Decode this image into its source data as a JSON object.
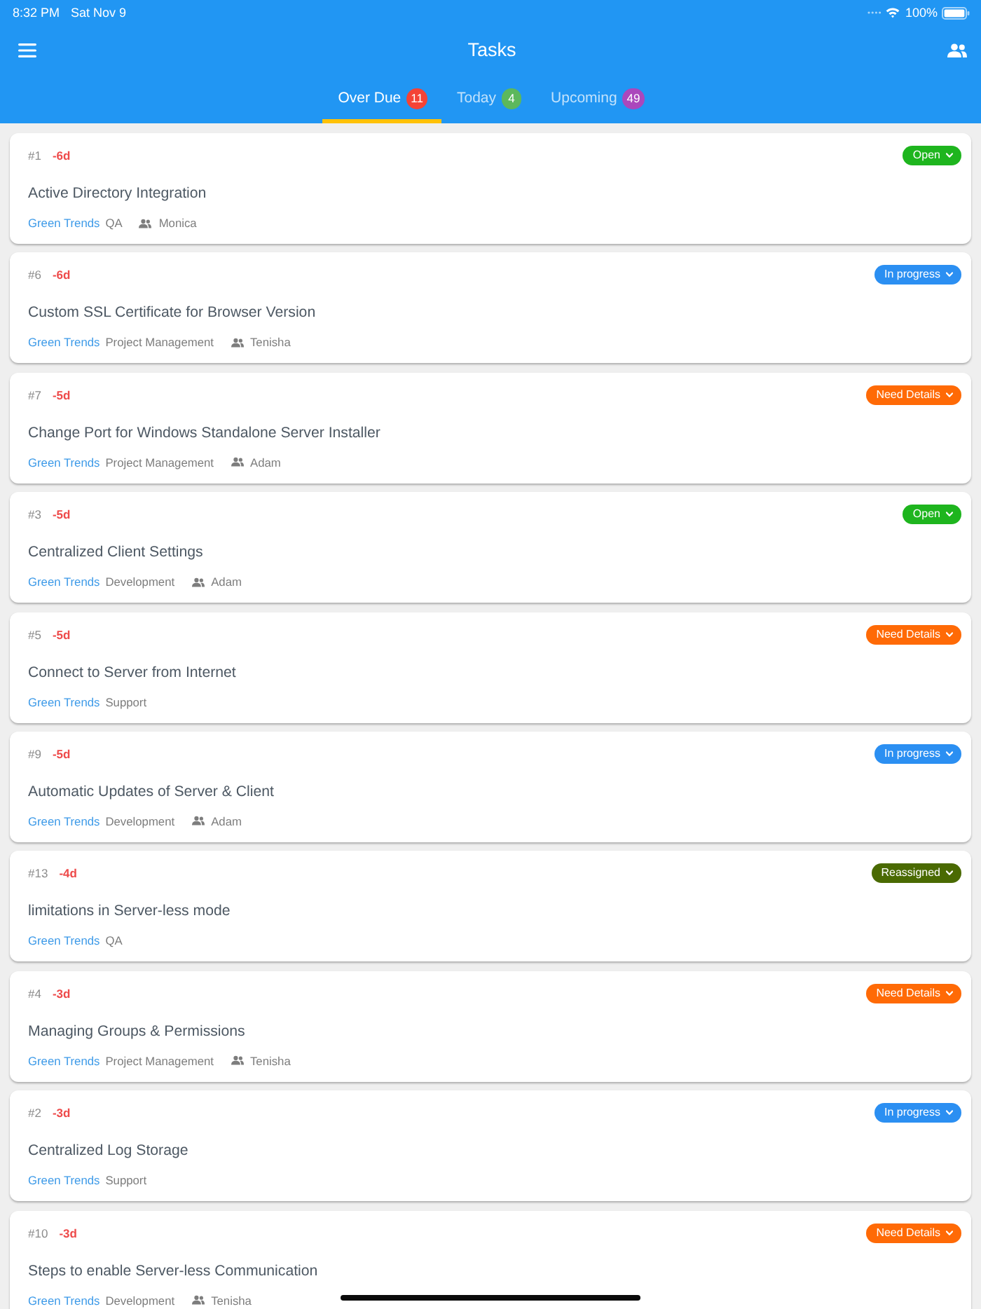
{
  "status_bar": {
    "time": "8:32 PM",
    "date": "Sat Nov 9",
    "battery": "100%"
  },
  "header": {
    "title": "Tasks"
  },
  "tabs": [
    {
      "label": "Over Due",
      "count": "11",
      "color": "#f44336",
      "selected": true
    },
    {
      "label": "Today",
      "count": "4",
      "color": "#5cb85c",
      "selected": false
    },
    {
      "label": "Upcoming",
      "count": "49",
      "color": "#ab47bc",
      "selected": false
    }
  ],
  "tasks": [
    {
      "id": "#1",
      "due": "-6d",
      "status": "Open",
      "color": "#1eb51e",
      "title": "Active Directory Integration",
      "project": "Green Trends",
      "category": "QA",
      "assignee": "Monica"
    },
    {
      "id": "#6",
      "due": "-6d",
      "status": "In progress",
      "color": "#2b8ff2",
      "title": "Custom SSL Certificate for Browser Version",
      "project": "Green Trends",
      "category": "Project Management",
      "assignee": "Tenisha"
    },
    {
      "id": "#7",
      "due": "-5d",
      "status": "Need Details",
      "color": "#ff6a06",
      "title": "Change Port for Windows Standalone Server Installer",
      "project": "Green Trends",
      "category": "Project Management",
      "assignee": "Adam"
    },
    {
      "id": "#3",
      "due": "-5d",
      "status": "Open",
      "color": "#1eb51e",
      "title": "Centralized Client Settings",
      "project": "Green Trends",
      "category": "Development",
      "assignee": "Adam"
    },
    {
      "id": "#5",
      "due": "-5d",
      "status": "Need Details",
      "color": "#ff6a06",
      "title": "Connect to Server from Internet",
      "project": "Green Trends",
      "category": "Support"
    },
    {
      "id": "#9",
      "due": "-5d",
      "status": "In progress",
      "color": "#2b8ff2",
      "title": "Automatic Updates of Server & Client",
      "project": "Green Trends",
      "category": "Development",
      "assignee": "Adam"
    },
    {
      "id": "#13",
      "due": "-4d",
      "status": "Reassigned",
      "color": "#4a6a02",
      "title": "limitations in Server-less mode",
      "project": "Green Trends",
      "category": "QA"
    },
    {
      "id": "#4",
      "due": "-3d",
      "status": "Need Details",
      "color": "#ff6a06",
      "title": "Managing Groups & Permissions",
      "project": "Green Trends",
      "category": "Project Management",
      "assignee": "Tenisha"
    },
    {
      "id": "#2",
      "due": "-3d",
      "status": "In progress",
      "color": "#2b8ff2",
      "title": "Centralized Log Storage",
      "project": "Green Trends",
      "category": "Support"
    },
    {
      "id": "#10",
      "due": "-3d",
      "status": "Need Details",
      "color": "#ff6a06",
      "title": "Steps to enable Server-less Communication",
      "project": "Green Trends",
      "category": "Development",
      "assignee": "Tenisha"
    }
  ]
}
